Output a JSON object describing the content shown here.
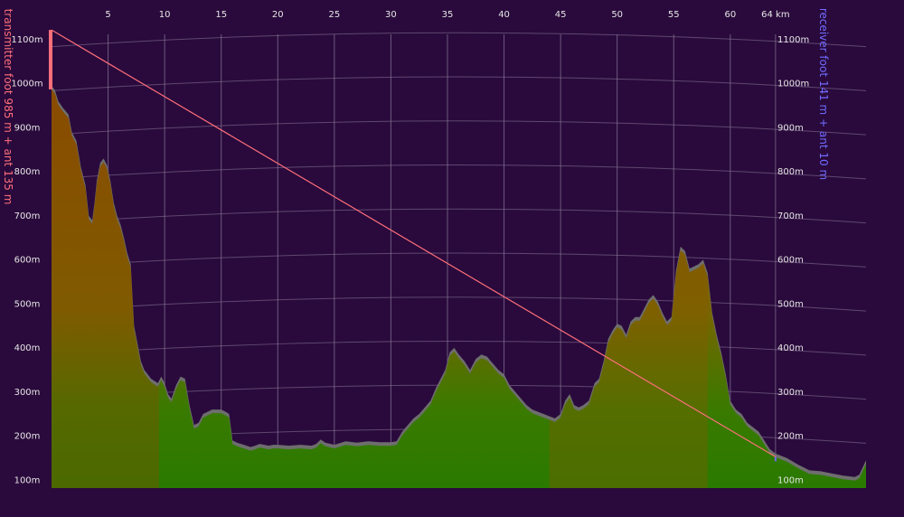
{
  "chart_data": {
    "type": "area",
    "title": "",
    "x_unit": "km",
    "x_ticks": [
      5,
      10,
      15,
      20,
      25,
      30,
      35,
      40,
      45,
      50,
      55,
      60,
      64
    ],
    "x_tick_labels": [
      "5",
      "10",
      "15",
      "20",
      "25",
      "30",
      "35",
      "40",
      "45",
      "50",
      "55",
      "60",
      "64 km"
    ],
    "xlim": [
      0,
      72
    ],
    "ylim": [
      80,
      1110
    ],
    "y_ticks": [
      100,
      200,
      300,
      400,
      500,
      600,
      700,
      800,
      900,
      1000,
      1100
    ],
    "y_tick_labels": [
      "100m",
      "200m",
      "300m",
      "400m",
      "500m",
      "600m",
      "700m",
      "800m",
      "900m",
      "1000m",
      "1100m"
    ],
    "grid": true,
    "left_label": "transmitter foot 985 m + ant 135 m",
    "right_label": "receiver foot 141 m + ant 10 m",
    "transmitter": {
      "distance_km": 0,
      "foot_m": 985,
      "antenna_m": 135
    },
    "receiver": {
      "distance_km": 64,
      "foot_m": 141,
      "antenna_m": 10
    },
    "terrain": {
      "x": [
        0,
        0.3,
        0.6,
        1.0,
        1.5,
        1.8,
        2.2,
        2.6,
        3.0,
        3.3,
        3.6,
        3.8,
        4.0,
        4.3,
        4.6,
        4.9,
        5.2,
        5.5,
        5.8,
        6.1,
        6.4,
        6.7,
        7.0,
        7.3,
        7.6,
        7.9,
        8.2,
        8.5,
        8.8,
        9.1,
        9.4,
        9.7,
        10.0,
        10.3,
        10.6,
        11.0,
        11.4,
        11.8,
        12.2,
        12.6,
        13.0,
        13.4,
        13.8,
        14.2,
        14.6,
        15.0,
        15.4,
        15.7,
        16.0,
        16.4,
        17.0,
        17.6,
        18.0,
        18.4,
        18.8,
        19.2,
        19.6,
        20.0,
        21.0,
        22.0,
        23.0,
        23.4,
        23.8,
        24.2,
        25.0,
        26.0,
        27.0,
        28.0,
        29.0,
        30.0,
        30.5,
        31.0,
        32.0,
        32.5,
        33.0,
        33.5,
        34.0,
        34.4,
        34.8,
        35.2,
        35.6,
        36.0,
        36.5,
        37.0,
        37.5,
        38.0,
        38.5,
        39.0,
        39.5,
        40.0,
        40.5,
        41.0,
        41.5,
        42.0,
        42.5,
        43.0,
        43.5,
        44.0,
        44.5,
        45.0,
        45.4,
        45.8,
        46.2,
        46.6,
        47.0,
        47.5,
        48.0,
        48.4,
        48.8,
        49.2,
        49.6,
        50.0,
        50.4,
        50.8,
        51.2,
        51.6,
        52.0,
        52.4,
        52.8,
        53.2,
        53.6,
        54.0,
        54.4,
        54.8,
        55.2,
        55.6,
        56.0,
        56.4,
        56.8,
        57.2,
        57.6,
        58.0,
        58.4,
        58.8,
        59.2,
        59.6,
        60.0,
        60.5,
        61.0,
        61.5,
        62.0,
        62.5,
        63.0,
        63.5,
        64.0,
        65.0,
        66.0,
        67.0,
        68.0,
        69.0,
        70.0,
        71.0,
        71.4,
        72.0
      ],
      "y": [
        985,
        975,
        950,
        935,
        920,
        880,
        860,
        800,
        760,
        690,
        680,
        720,
        770,
        810,
        820,
        805,
        770,
        720,
        690,
        670,
        640,
        605,
        580,
        440,
        400,
        360,
        340,
        330,
        320,
        315,
        310,
        325,
        310,
        285,
        275,
        305,
        325,
        320,
        260,
        215,
        220,
        240,
        245,
        250,
        250,
        250,
        245,
        240,
        180,
        175,
        170,
        165,
        168,
        172,
        170,
        168,
        170,
        170,
        168,
        170,
        168,
        172,
        182,
        175,
        170,
        178,
        175,
        178,
        176,
        176,
        178,
        200,
        230,
        240,
        255,
        270,
        300,
        320,
        340,
        380,
        390,
        375,
        360,
        340,
        365,
        375,
        370,
        355,
        340,
        330,
        305,
        290,
        275,
        260,
        250,
        245,
        240,
        235,
        230,
        240,
        270,
        285,
        260,
        255,
        260,
        270,
        310,
        320,
        360,
        410,
        430,
        445,
        440,
        420,
        450,
        460,
        460,
        480,
        500,
        510,
        495,
        470,
        450,
        460,
        565,
        620,
        610,
        570,
        575,
        580,
        590,
        560,
        470,
        420,
        380,
        330,
        270,
        250,
        240,
        220,
        210,
        200,
        180,
        160,
        150,
        140,
        125,
        112,
        110,
        105,
        100,
        97,
        102,
        135
      ]
    },
    "haze_bands": [
      {
        "x0": 0,
        "x1": 9.5,
        "color": "#8a4a00"
      },
      {
        "x0": 44,
        "x1": 58,
        "color": "#8a5a00"
      }
    ],
    "colors": {
      "background": "#2a0a3c",
      "terrain_low": "#2a7a00",
      "terrain_high": "#8a4c00",
      "terrain_edge": "#6e6e6e",
      "sightline": "#ff6f7a",
      "transmitter": "#ff6f7a",
      "receiver": "#6f6cff",
      "gridline": "#8a7a9a",
      "tick_text": "#e6e6e6"
    }
  }
}
